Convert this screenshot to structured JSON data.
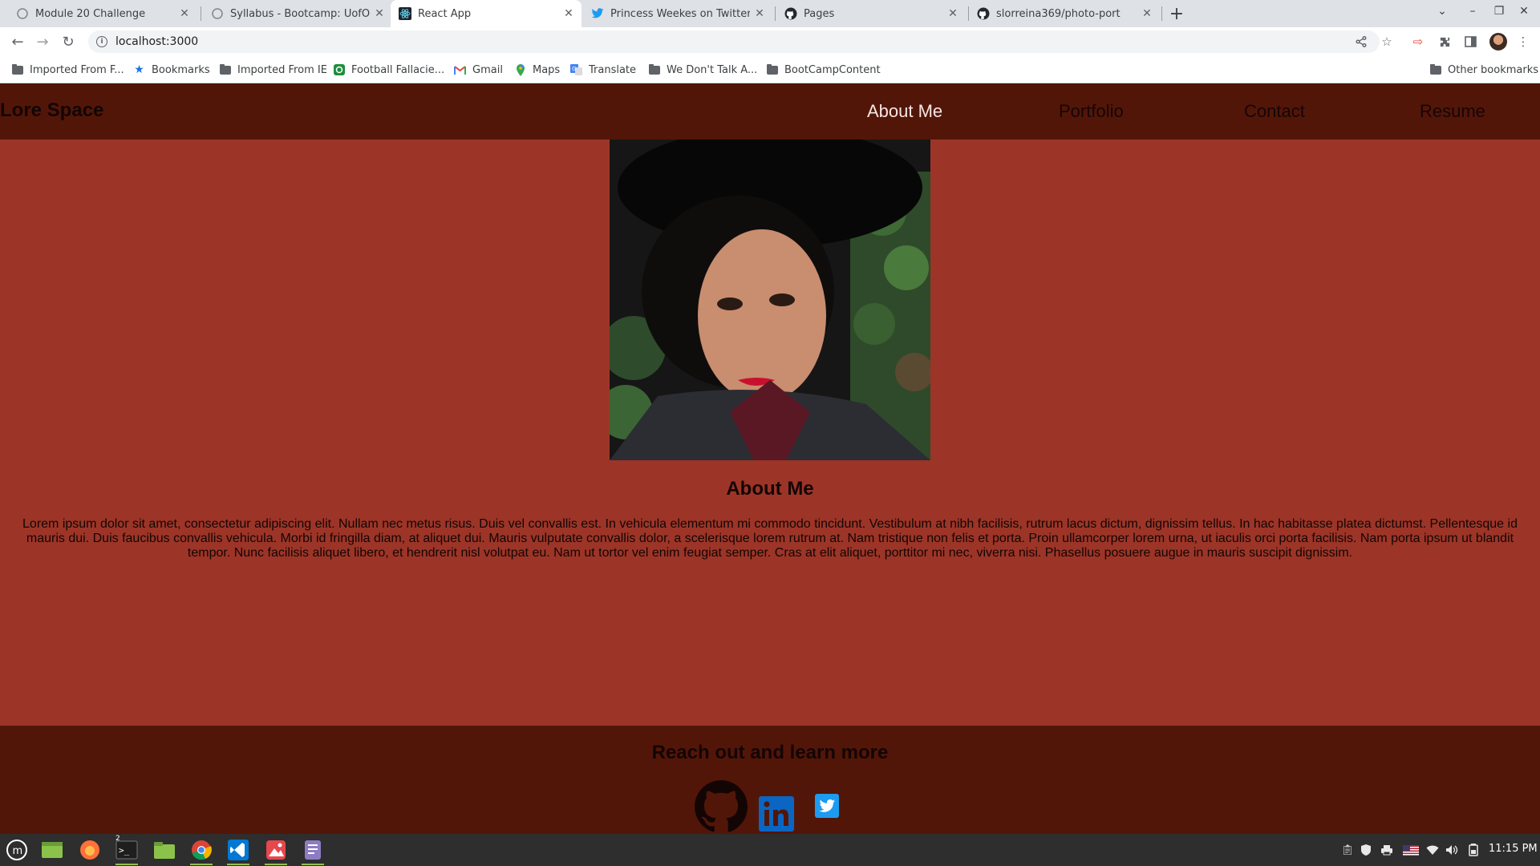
{
  "browser": {
    "tabs": [
      {
        "title": "Module 20 Challenge",
        "icon": "blank-page-icon"
      },
      {
        "title": "Syllabus - Bootcamp: UofO-V",
        "icon": "blank-page-icon"
      },
      {
        "title": "React App",
        "icon": "react-icon"
      },
      {
        "title": "Princess Weekes on Twitter: \"I",
        "icon": "twitter-icon"
      },
      {
        "title": "Pages",
        "icon": "github-icon"
      },
      {
        "title": "slorreina369/photo-port",
        "icon": "github-icon"
      }
    ],
    "url": "localhost:3000",
    "bookmarks": [
      {
        "label": "Imported From F...",
        "icon": "folder-icon"
      },
      {
        "label": "Bookmarks",
        "icon": "star-icon"
      },
      {
        "label": "Imported From IE",
        "icon": "folder-icon"
      },
      {
        "label": "Football Fallacie...",
        "icon": "site-icon"
      },
      {
        "label": "Gmail",
        "icon": "gmail-icon"
      },
      {
        "label": "Maps",
        "icon": "maps-icon"
      },
      {
        "label": "Translate",
        "icon": "translate-icon"
      },
      {
        "label": "We Don't Talk A...",
        "icon": "folder-icon"
      },
      {
        "label": "BootCampContent",
        "icon": "folder-icon"
      }
    ],
    "other_bookmarks": "Other bookmarks"
  },
  "site": {
    "brand": "Lore Space",
    "nav": [
      {
        "label": "About Me",
        "active": true
      },
      {
        "label": "Portfolio",
        "active": false
      },
      {
        "label": "Contact",
        "active": false
      },
      {
        "label": "Resume",
        "active": false
      }
    ],
    "about": {
      "title": "About Me",
      "text": "Lorem ipsum dolor sit amet, consectetur adipiscing elit. Nullam nec metus risus. Duis vel convallis est. In vehicula elementum mi commodo tincidunt. Vestibulum at nibh facilisis, rutrum lacus dictum, dignissim tellus. In hac habitasse platea dictumst. Pellentesque id mauris dui. Duis faucibus convallis vehicula. Morbi id fringilla diam, at aliquet dui. Mauris vulputate convallis dolor, a scelerisque lorem rutrum at. Nam tristique non felis et porta. Proin ullamcorper lorem urna, ut iaculis orci porta facilisis. Nam porta ipsum ut blandit tempor. Nunc facilisis aliquet libero, et hendrerit nisl volutpat eu. Nam ut tortor vel enim feugiat semper. Cras at elit aliquet, porttitor mi nec, viverra nisi. Phasellus posuere augue in mauris suscipit dignissim."
    },
    "footer": {
      "title": "Reach out and learn more",
      "social": [
        "github-icon",
        "linkedin-icon",
        "twitter-icon"
      ]
    }
  },
  "colors": {
    "header_bg": "#521608",
    "page_bg": "#9c3527",
    "active_nav": "#f6e6e2",
    "linkedin_blue": "#0a66c2",
    "twitter_blue": "#1d9bf0"
  },
  "taskbar": {
    "clock": "11:15 PM",
    "terminal_badge": "2"
  }
}
